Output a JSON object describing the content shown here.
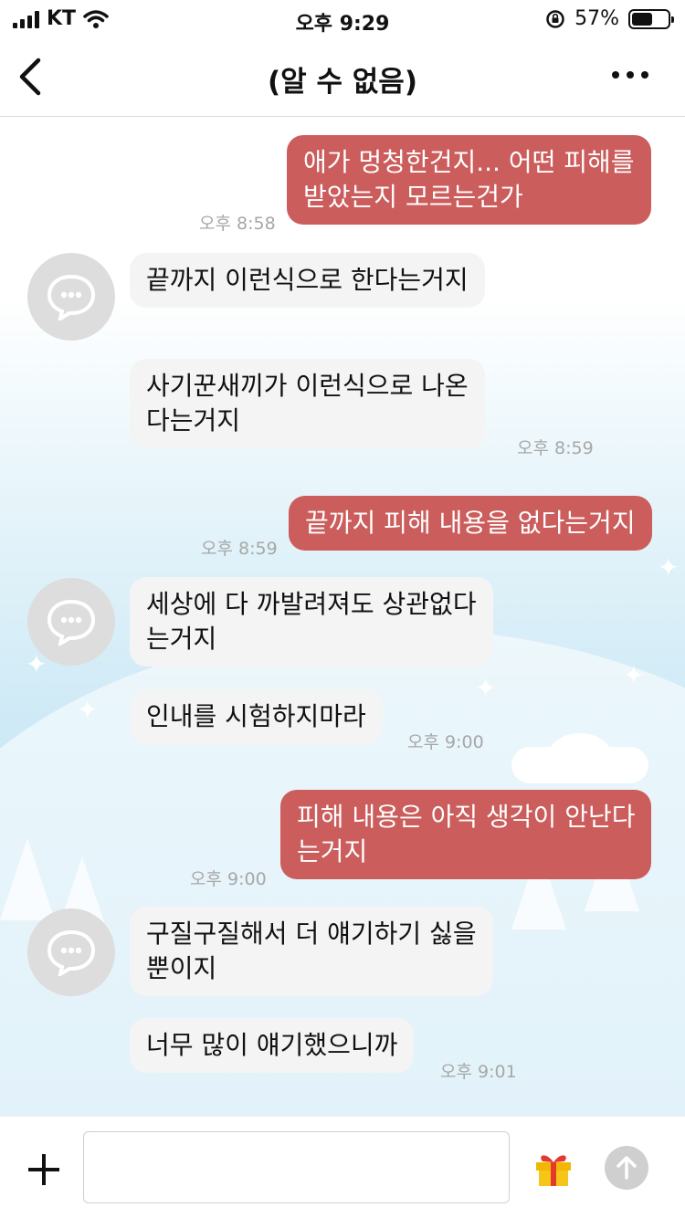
{
  "status_bar": {
    "carrier": "KT",
    "time": "오후 9:29",
    "battery_percent": "57%",
    "battery_level": 0.57
  },
  "header": {
    "title": "(알 수 없음)"
  },
  "messages": [
    {
      "side": "out",
      "lines": [
        "애가 멍청한건지... 어떤 피해를",
        "받았는지 모르는건가"
      ],
      "time": "오후 8:58"
    },
    {
      "side": "in",
      "lines": [
        "끝까지 이런식으로 한다는거지"
      ],
      "time": ""
    },
    {
      "side": "in",
      "lines": [
        "사기꾼새끼가 이런식으로 나온",
        "다는거지"
      ],
      "time": "오후 8:59"
    },
    {
      "side": "out",
      "lines": [
        "끝까지 피해 내용을 없다는거지"
      ],
      "time": "오후 8:59"
    },
    {
      "side": "in",
      "lines": [
        "세상에 다 까발려져도 상관없다",
        "는거지"
      ],
      "time": ""
    },
    {
      "side": "in",
      "lines": [
        "인내를 시험하지마라"
      ],
      "time": "오후 9:00"
    },
    {
      "side": "out",
      "lines": [
        "피해 내용은 아직 생각이 안난다",
        "는거지"
      ],
      "time": "오후 9:00"
    },
    {
      "side": "in",
      "lines": [
        "구질구질해서 더 얘기하기 싫을",
        "뿐이지"
      ],
      "time": ""
    },
    {
      "side": "in",
      "lines": [
        "너무 많이 얘기했으니까"
      ],
      "time": "오후 9:01"
    }
  ],
  "colors": {
    "outgoing_bubble": "#cb5d5c",
    "incoming_bubble": "#f4f4f4",
    "timestamp": "#a7a7a7"
  },
  "icons": {
    "back": "chevron-left-icon",
    "more": "more-dots-icon",
    "attach": "plus-icon",
    "gift": "gift-icon",
    "send": "send-arrow-icon",
    "avatar": "default-avatar-icon"
  }
}
